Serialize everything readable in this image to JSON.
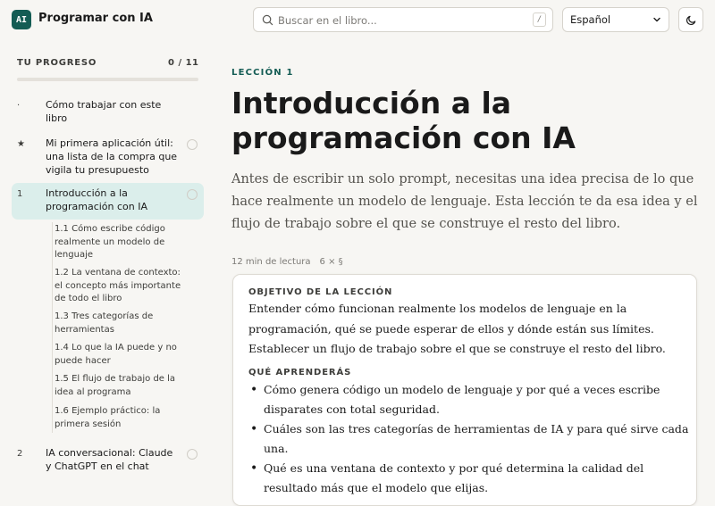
{
  "header": {
    "logo_text": "AI",
    "app_title": "Programar con IA",
    "search_placeholder": "Buscar en el libro...",
    "search_shortcut": "/",
    "language_selected": "Español",
    "theme_icon": "moon-icon"
  },
  "sidebar": {
    "progress_label": "TU PROGRESO",
    "progress_count": "0 / 11",
    "progress_fraction": 0,
    "items": [
      {
        "num": "·",
        "label": "Cómo trabajar con este libro"
      },
      {
        "num": "★",
        "label": "Mi primera aplicación útil: una lista de la compra que vigila tu presupuesto"
      },
      {
        "num": "1",
        "label": "Introducción a la programación con IA"
      },
      {
        "num": "2",
        "label": "IA conversacional: Claude y ChatGPT en el chat"
      }
    ],
    "subitems": [
      {
        "label": "1.1  Cómo escribe código realmente un modelo de lenguaje"
      },
      {
        "label": "1.2  La ventana de contexto: el concepto más importante de todo el libro"
      },
      {
        "label": "1.3  Tres categorías de herramientas"
      },
      {
        "label": "1.4  Lo que la IA puede y no puede hacer"
      },
      {
        "label": "1.5  El flujo de trabajo de la idea al programa"
      },
      {
        "label": "1.6  Ejemplo práctico: la primera sesión"
      }
    ]
  },
  "main": {
    "eyebrow": "LECCIÓN 1",
    "title": "Introducción a la programación con IA",
    "intro": "Antes de escribir un solo prompt, necesitas una idea precisa de lo que hace realmente un modelo de lenguaje. Esta lección te da esa idea y el flujo de trabajo sobre el que se construye el resto del libro.",
    "reading_time": "12 min de lectura",
    "sections": "6 × §",
    "objective_heading": "OBJETIVO DE LA LECCIÓN",
    "objective_text": "Entender cómo funcionan realmente los modelos de lenguaje en la programación, qué se puede esperar de ellos y dónde están sus límites. Establecer un flujo de trabajo sobre el que se construye el resto del libro.",
    "learn_heading": "QUÉ APRENDERÁS",
    "learn_items": [
      "Cómo genera código un modelo de lenguaje y por qué a veces escribe disparates con total seguridad.",
      "Cuáles son las tres categorías de herramientas de IA y para qué sirve cada una.",
      "Qué es una ventana de contexto y por qué determina la calidad del resultado más que el modelo que elijas."
    ]
  },
  "colors": {
    "accent": "#145c54",
    "active_bg": "#dbeeeb",
    "page_bg": "#f7f6f3"
  }
}
